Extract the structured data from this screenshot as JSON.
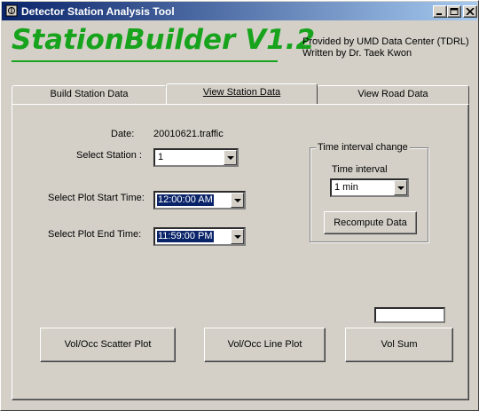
{
  "window": {
    "title": "Detector Station Analysis Tool"
  },
  "header": {
    "logo": "StationBuilder V1.2",
    "credit_line1": "Provided by UMD Data Center (TDRL)",
    "credit_line2": "Written by Dr. Taek Kwon"
  },
  "tabs": [
    {
      "label": "Build Station Data"
    },
    {
      "label": "View Station Data"
    },
    {
      "label": "View Road Data"
    }
  ],
  "main": {
    "date_label": "Date:",
    "date_value": "20010621.traffic",
    "station_label": "Select Station :",
    "station_value": "1",
    "start_label": "Select Plot Start Time:",
    "start_value": "12:00:00 AM",
    "end_label": "Select Plot End Time:",
    "end_value": "11:59:00 PM",
    "interval_group_title": "Time interval change",
    "interval_label": "Time interval",
    "interval_value": "1 min",
    "recompute_label": "Recompute Data",
    "sum_value": "",
    "scatter_label": "Vol/Occ Scatter Plot",
    "line_label": "Vol/Occ Line Plot",
    "volsum_label": "Vol Sum"
  },
  "colors": {
    "titlebar_start": "#0a246a",
    "titlebar_end": "#a6caf0",
    "logo": "#17a31c",
    "face": "#d4d0c8"
  }
}
